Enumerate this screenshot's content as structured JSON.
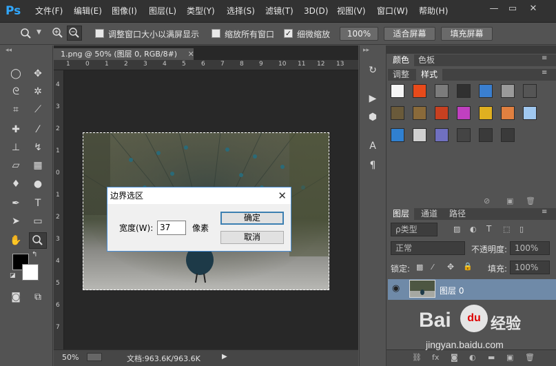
{
  "app": {
    "logo": "Ps"
  },
  "menu": [
    "文件(F)",
    "编辑(E)",
    "图像(I)",
    "图层(L)",
    "类型(Y)",
    "选择(S)",
    "滤镜(T)",
    "3D(D)",
    "视图(V)",
    "窗口(W)",
    "帮助(H)"
  ],
  "window_controls": {
    "minimize": "—",
    "restore": "▭",
    "close": "✕"
  },
  "options": {
    "tool_icon": "zoom-icon",
    "resize_windows_label": "调整窗口大小以满屏显示",
    "zoom_all_label": "缩放所有窗口",
    "scrubby_zoom_label": "细微缩放",
    "scrubby_zoom_checked": true,
    "btn_100": "100%",
    "btn_fit": "适合屏幕",
    "btn_fill": "填充屏幕"
  },
  "document": {
    "tab_title": "1.png @ 50% (图层 0, RGB/8#)",
    "tab_close": "✕",
    "ruler_h_ticks": [
      "1",
      "0",
      "1",
      "2",
      "3",
      "4",
      "5",
      "6",
      "7",
      "8",
      "9",
      "10",
      "11",
      "12",
      "13"
    ],
    "ruler_v_ticks": [
      "4",
      "3",
      "2",
      "1",
      "0",
      "1",
      "2",
      "3",
      "4",
      "5",
      "6",
      "7"
    ]
  },
  "status": {
    "zoom": "50%",
    "doc_info": "文档:963.6K/963.6K",
    "arrow": "▶"
  },
  "dialog": {
    "title": "边界选区",
    "close": "✕",
    "width_label": "宽度(W):",
    "width_value": "37",
    "unit": "像素",
    "ok": "确定",
    "cancel": "取消"
  },
  "panels": {
    "top_tabs": [
      "颜色",
      "色板"
    ],
    "second_tabs": [
      "调整",
      "样式"
    ],
    "style_colors": [
      "#f5f5f5",
      "#e84a1a",
      "#7c7c7c",
      "#303030",
      "#3a7fd0",
      "#9a9a9a",
      "#555555",
      "#6a5a3a",
      "#8a6a3a",
      "#c84020",
      "#c040c0",
      "#e0b020",
      "#e08040",
      "#a0c8f0",
      "#3080d0",
      "#d0d0d0",
      "#7070c0",
      "#444444",
      "#3a3a3a",
      "#3a3a3a"
    ],
    "layer_tabs": [
      "图层",
      "通道",
      "路径"
    ],
    "filter_label": "ρ类型",
    "blend_mode": "正常",
    "opacity_label": "不透明度:",
    "opacity_value": "100%",
    "lock_label": "锁定:",
    "fill_label": "填充:",
    "fill_value": "100%",
    "layer_name": "图层 0"
  },
  "watermark": {
    "brand": "Bai",
    "paw": "du",
    "suffix": "经验",
    "url": "jingyan.baidu.com"
  }
}
